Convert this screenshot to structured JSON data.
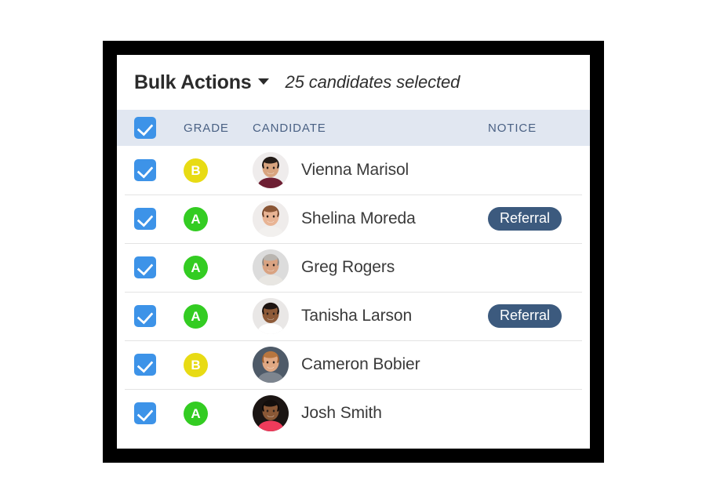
{
  "frame": {
    "border_color": "#000000",
    "panel_background": "#ffffff"
  },
  "toolbar": {
    "bulk_actions_label": "Bulk Actions",
    "caret_icon": "chevron-down-icon",
    "selection_status": "25 candidates selected"
  },
  "table": {
    "header_background": "#e1e7f1",
    "header_text_color": "#4a6184",
    "columns": [
      {
        "key": "select",
        "label": ""
      },
      {
        "key": "grade",
        "label": "GRADE"
      },
      {
        "key": "candidate",
        "label": "CANDIDATE"
      },
      {
        "key": "notice",
        "label": "NOTICE"
      }
    ],
    "select_all_checked": true,
    "checkbox_color": "#3d93e8",
    "grade_colors": {
      "A": "#33cc22",
      "B": "#e8db14"
    },
    "notice_badge_color": "#3c5a7e",
    "rows": [
      {
        "selected": true,
        "grade": "B",
        "name": "Vienna Marisol",
        "notice": "",
        "avatar": "photo-woman-dark-hair"
      },
      {
        "selected": true,
        "grade": "A",
        "name": "Shelina Moreda",
        "notice": "Referral",
        "avatar": "photo-woman-auburn-hair"
      },
      {
        "selected": true,
        "grade": "A",
        "name": "Greg Rogers",
        "notice": "",
        "avatar": "photo-man-grey-hair"
      },
      {
        "selected": true,
        "grade": "A",
        "name": "Tanisha Larson",
        "notice": "Referral",
        "avatar": "photo-woman-curly-hair"
      },
      {
        "selected": true,
        "grade": "B",
        "name": "Cameron Bobier",
        "notice": "",
        "avatar": "photo-man-glasses-beard"
      },
      {
        "selected": true,
        "grade": "A",
        "name": "Josh Smith",
        "notice": "",
        "avatar": "photo-man-goatee"
      }
    ]
  }
}
